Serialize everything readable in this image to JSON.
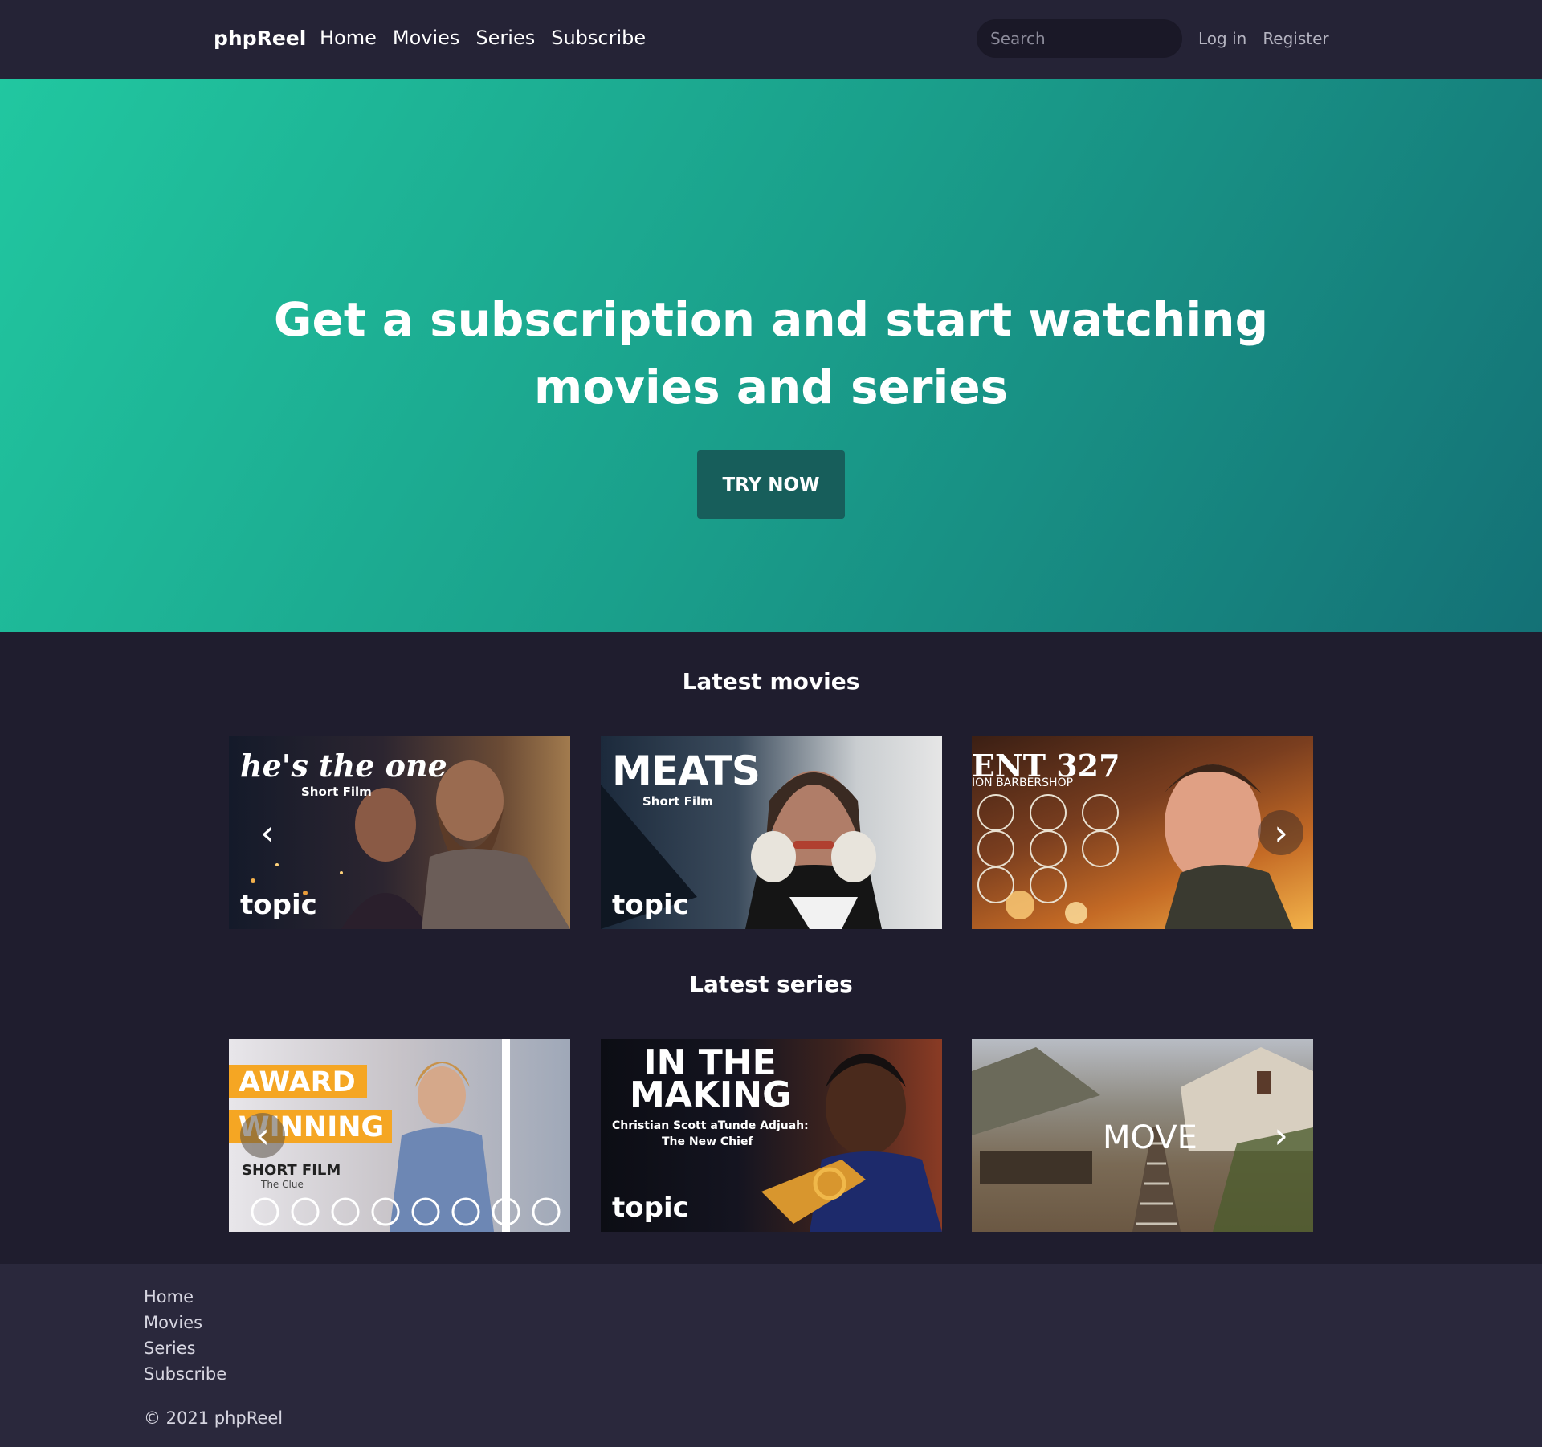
{
  "nav": {
    "brand": "phpReel",
    "links": [
      "Home",
      "Movies",
      "Series",
      "Subscribe"
    ],
    "search_placeholder": "Search",
    "login": "Log in",
    "register": "Register"
  },
  "hero": {
    "headline": "Get a subscription and start watching movies and series",
    "cta": "TRY NOW"
  },
  "movies": {
    "title": "Latest movies",
    "items": [
      {
        "poster_title": "he's the one",
        "poster_sub": "Short Film",
        "tag": "topic"
      },
      {
        "poster_title": "MEATS",
        "poster_sub": "Short Film",
        "tag": "topic"
      },
      {
        "poster_title": "ENT 327",
        "poster_sub": "ION BARBERSHOP",
        "tag": ""
      }
    ],
    "prev_icon": "‹",
    "next_icon": "›"
  },
  "series": {
    "title": "Latest series",
    "items": [
      {
        "poster_title": "AWARD",
        "poster_title2": "WINNING",
        "poster_sub": "SHORT FILM",
        "poster_sub2": "The Clue",
        "tag": ""
      },
      {
        "poster_title": "IN THE MAKING",
        "poster_sub": "Christian Scott aTunde Adjuah:",
        "poster_sub2": "The New Chief",
        "tag": "topic"
      },
      {
        "poster_title": "MOVE",
        "poster_sub": "",
        "tag": ""
      }
    ],
    "prev_icon": "‹",
    "next_icon": "›"
  },
  "footer": {
    "links": [
      "Home",
      "Movies",
      "Series",
      "Subscribe"
    ],
    "copyright": "© 2021 phpReel"
  },
  "colors": {
    "nav_bg": "#252336",
    "page_bg": "#1f1d2e",
    "hero_start": "#21c7a0",
    "hero_end": "#147176",
    "cta_bg": "#175e5b",
    "footer_bg": "#2a283c"
  }
}
